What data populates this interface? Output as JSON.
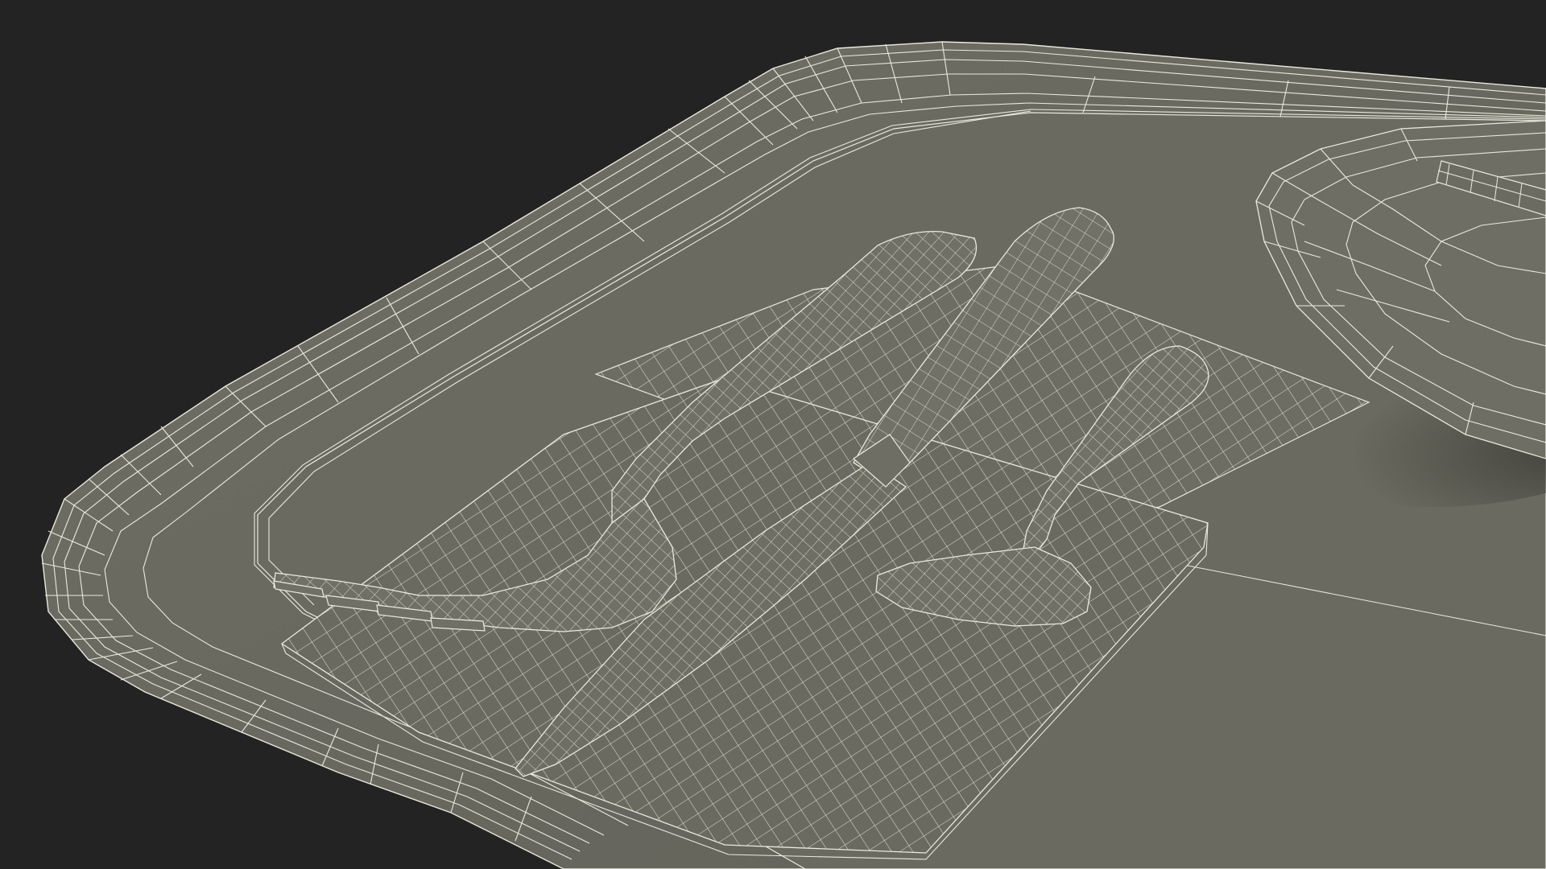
{
  "scene": {
    "style": "clay wireframe render",
    "objects": [
      {
        "name": "serving-tray"
      },
      {
        "name": "paper-napkin"
      },
      {
        "name": "fork"
      },
      {
        "name": "knife"
      },
      {
        "name": "spoon"
      },
      {
        "name": "plate"
      },
      {
        "name": "chopsticks"
      }
    ]
  },
  "colors": {
    "background": "#232323",
    "surface": "#6c6c62",
    "surface_dark": "#58584f",
    "surface_light": "#7a7a70",
    "wire": "#e9e9dc",
    "shadow": "#3f3f38"
  }
}
